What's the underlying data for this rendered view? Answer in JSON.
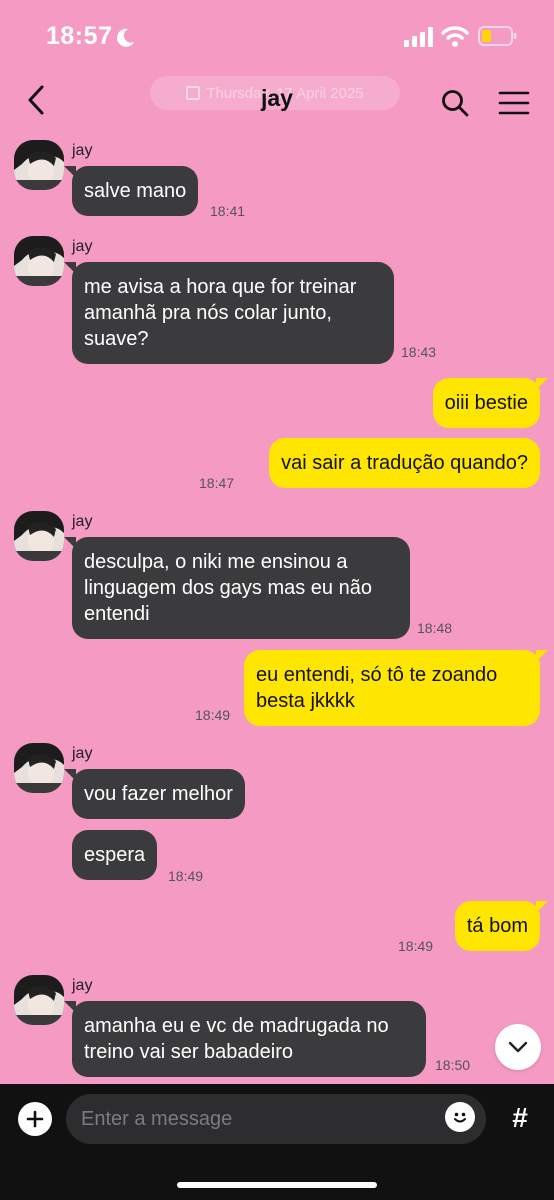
{
  "status_bar": {
    "time": "18:57",
    "battery_color": "#ffd60a"
  },
  "header": {
    "title": "jay",
    "date_label": "Thursday, 17 April 2025"
  },
  "messages": [
    {
      "direction": "in",
      "sender": "jay",
      "text": "salve mano",
      "time": "18:41"
    },
    {
      "direction": "in",
      "sender": "jay",
      "text": "me avisa a hora que for treinar amanhã pra nós colar junto, suave?",
      "time": "18:43"
    },
    {
      "direction": "out",
      "text": "oiii bestie"
    },
    {
      "direction": "out",
      "text": "vai sair a tradução quando?",
      "time": "18:47"
    },
    {
      "direction": "in",
      "sender": "jay",
      "text": "desculpa, o niki me ensinou a linguagem dos gays mas eu não entendi",
      "time": "18:48"
    },
    {
      "direction": "out",
      "text": "eu entendi, só tô te zoando besta jkkkk",
      "time": "18:49"
    },
    {
      "direction": "in",
      "sender": "jay",
      "text": "vou fazer melhor"
    },
    {
      "direction": "in",
      "text": "espera",
      "time": "18:49"
    },
    {
      "direction": "out",
      "text": "tá bom",
      "time": "18:49"
    },
    {
      "direction": "in",
      "sender": "jay",
      "text": "amanha eu e vc de madrugada no treino vai ser babadeiro",
      "time": "18:50"
    }
  ],
  "composer": {
    "placeholder": "Enter a message",
    "hash_label": "#"
  },
  "colors": {
    "background": "#f49ac3",
    "incoming_bubble": "#3b3b3d",
    "outgoing_bubble": "#ffe600",
    "composer": "#111111"
  }
}
